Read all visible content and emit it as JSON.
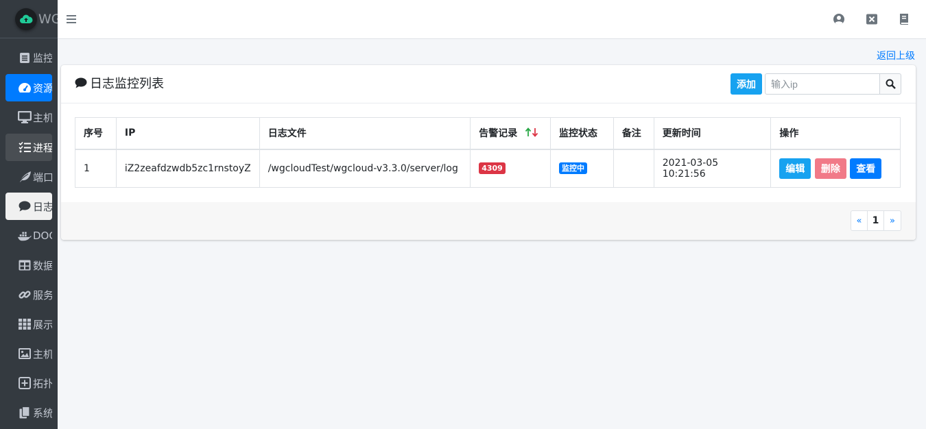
{
  "brand": {
    "text": "WG"
  },
  "sidebar": {
    "items": [
      {
        "label": "监控",
        "icon": "dashboard-list-icon"
      },
      {
        "label": "资源",
        "icon": "gauge-icon"
      },
      {
        "label": "主机",
        "icon": "monitor-icon"
      },
      {
        "label": "进程",
        "icon": "tasks-icon"
      },
      {
        "label": "端口",
        "icon": "leaf-icon"
      },
      {
        "label": "日志",
        "icon": "comment-icon"
      },
      {
        "label": "DOCKER",
        "icon": "docker-icon"
      },
      {
        "label": "数据",
        "icon": "table-icon"
      },
      {
        "label": "服务",
        "icon": "link-icon"
      },
      {
        "label": "展示",
        "icon": "grid-icon"
      },
      {
        "label": "主机",
        "icon": "image-icon"
      },
      {
        "label": "拓扑",
        "icon": "plus-square-icon"
      },
      {
        "label": "系统",
        "icon": "copy-icon"
      }
    ]
  },
  "topbar": {
    "icons": [
      "user-circle-icon",
      "close-box-icon",
      "book-icon"
    ]
  },
  "back_link": "返回上级",
  "card": {
    "title": "日志监控列表",
    "add_label": "添加",
    "search_placeholder": "输入ip"
  },
  "table": {
    "headers": [
      "序号",
      "IP",
      "日志文件",
      "告警记录",
      "监控状态",
      "备注",
      "更新时间",
      "操作"
    ],
    "rows": [
      {
        "index": "1",
        "ip": "iZ2zeafdzwdb5zc1rnstoyZ",
        "log_file": "/wgcloudTest/wgcloud-v3.3.0/server/log",
        "alarm_count": "4309",
        "status": "监控中",
        "remark": "",
        "update_time": "2021-03-05 10:21:56",
        "actions": {
          "edit": "编辑",
          "delete": "删除",
          "view": "查看"
        }
      }
    ]
  },
  "pagination": {
    "prev": "«",
    "current": "1",
    "next": "»"
  },
  "colors": {
    "sidebar_bg": "#343a40",
    "primary": "#007bff",
    "info": "#17a2f0",
    "danger": "#dc3545",
    "delete_btn": "#f17a88"
  }
}
